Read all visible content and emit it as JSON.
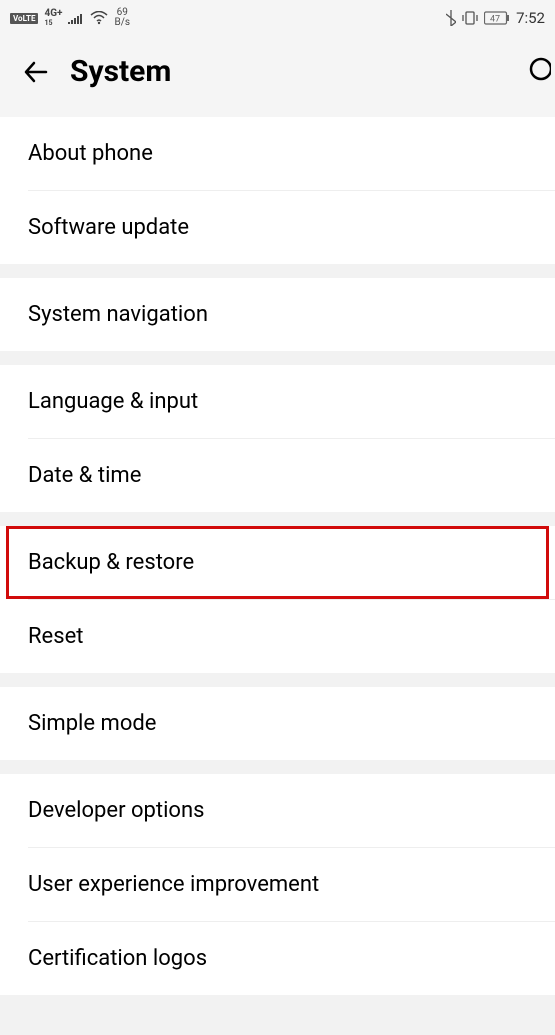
{
  "status_bar": {
    "volte": "VoLTE",
    "network": "4G+",
    "network_sub": "15",
    "speed_value": "69",
    "speed_unit": "B/s",
    "battery": "47",
    "time": "7:52"
  },
  "header": {
    "title": "System"
  },
  "groups": [
    {
      "rows": [
        {
          "key": "about_phone",
          "label": "About phone"
        },
        {
          "key": "software_update",
          "label": "Software update"
        }
      ]
    },
    {
      "rows": [
        {
          "key": "system_navigation",
          "label": "System navigation"
        }
      ]
    },
    {
      "rows": [
        {
          "key": "language_input",
          "label": "Language & input"
        },
        {
          "key": "date_time",
          "label": "Date & time"
        }
      ]
    },
    {
      "rows": [
        {
          "key": "backup_restore",
          "label": "Backup & restore",
          "highlighted": true
        },
        {
          "key": "reset",
          "label": "Reset"
        }
      ]
    },
    {
      "rows": [
        {
          "key": "simple_mode",
          "label": "Simple mode"
        }
      ]
    },
    {
      "rows": [
        {
          "key": "developer_options",
          "label": "Developer options"
        },
        {
          "key": "user_experience",
          "label": "User experience improvement"
        },
        {
          "key": "certification_logos",
          "label": "Certification logos"
        }
      ]
    }
  ]
}
